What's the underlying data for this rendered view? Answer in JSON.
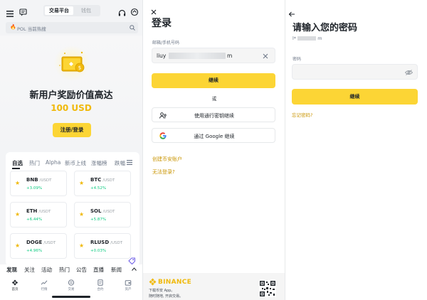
{
  "panel_home": {
    "segment": {
      "active": "交易平台",
      "inactive": "钱包"
    },
    "search": {
      "placeholder": "POL 当前热搜"
    },
    "promo": {
      "title": "新用户奖励价值高达",
      "amount": "100 USD",
      "button": "注册/登录"
    },
    "market_tabs": [
      "自选",
      "热门",
      "Alpha",
      "新币上线",
      "涨幅榜",
      "跌幅"
    ],
    "coins": [
      {
        "symbol": "BNB",
        "pair": "/USDT",
        "change": "+3.09%"
      },
      {
        "symbol": "BTC",
        "pair": "/USDT",
        "change": "+4.52%"
      },
      {
        "symbol": "ETH",
        "pair": "/USDT",
        "change": "+6.44%"
      },
      {
        "symbol": "SOL",
        "pair": "/USDT",
        "change": "+5.87%"
      },
      {
        "symbol": "DOGE",
        "pair": "/USDT",
        "change": "+4.96%"
      },
      {
        "symbol": "RLUSD",
        "pair": "/USDT",
        "change": "+0.03%"
      }
    ],
    "feed_tabs": [
      "发现",
      "关注",
      "活动",
      "热门",
      "公告",
      "直播",
      "新闻"
    ],
    "bottom_tabs": [
      "首页",
      "行情",
      "交易",
      "合约",
      "资产"
    ]
  },
  "panel_login": {
    "title": "登录",
    "field_label": "邮箱/手机号码",
    "field_value_prefix": "liuy",
    "field_value_suffix": "m",
    "continue": "继续",
    "or": "或",
    "passkey": "使用通行密钥继续",
    "google": "通过 Google 继续",
    "create_account": "创建币安账户",
    "cannot_login": "无法登录?",
    "brand": "BINANCE",
    "footer_line1": "下载币安 App。",
    "footer_line2": "随时随地, 开启交易。"
  },
  "panel_password": {
    "title": "请输入您的密码",
    "account_prefix": "l*",
    "account_suffix": "m",
    "field_label": "密码",
    "continue": "继续",
    "forgot": "忘记密码?"
  },
  "colors": {
    "accent": "#fcd535",
    "link": "#c99400",
    "up": "#0ecb81",
    "text": "#1e2329"
  }
}
